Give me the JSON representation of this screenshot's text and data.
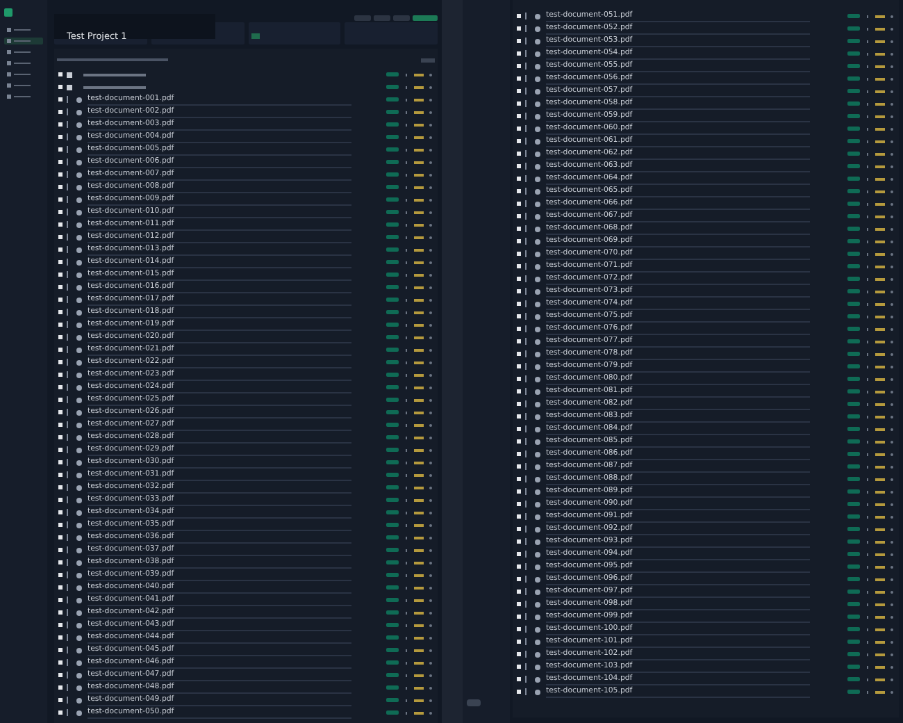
{
  "project": {
    "title": "Test Project 1"
  },
  "sidebar": {
    "items": [
      {
        "selected": false
      },
      {
        "selected": true
      },
      {
        "selected": false
      },
      {
        "selected": false
      },
      {
        "selected": false
      },
      {
        "selected": false
      },
      {
        "selected": false
      }
    ]
  },
  "left_documents": [
    "test-document-001.pdf",
    "test-document-002.pdf",
    "test-document-003.pdf",
    "test-document-004.pdf",
    "test-document-005.pdf",
    "test-document-006.pdf",
    "test-document-007.pdf",
    "test-document-008.pdf",
    "test-document-009.pdf",
    "test-document-010.pdf",
    "test-document-011.pdf",
    "test-document-012.pdf",
    "test-document-013.pdf",
    "test-document-014.pdf",
    "test-document-015.pdf",
    "test-document-016.pdf",
    "test-document-017.pdf",
    "test-document-018.pdf",
    "test-document-019.pdf",
    "test-document-020.pdf",
    "test-document-021.pdf",
    "test-document-022.pdf",
    "test-document-023.pdf",
    "test-document-024.pdf",
    "test-document-025.pdf",
    "test-document-026.pdf",
    "test-document-027.pdf",
    "test-document-028.pdf",
    "test-document-029.pdf",
    "test-document-030.pdf",
    "test-document-031.pdf",
    "test-document-032.pdf",
    "test-document-033.pdf",
    "test-document-034.pdf",
    "test-document-035.pdf",
    "test-document-036.pdf",
    "test-document-037.pdf",
    "test-document-038.pdf",
    "test-document-039.pdf",
    "test-document-040.pdf",
    "test-document-041.pdf",
    "test-document-042.pdf",
    "test-document-043.pdf",
    "test-document-044.pdf",
    "test-document-045.pdf",
    "test-document-046.pdf",
    "test-document-047.pdf",
    "test-document-048.pdf",
    "test-document-049.pdf",
    "test-document-050.pdf"
  ],
  "right_documents": [
    "test-document-051.pdf",
    "test-document-052.pdf",
    "test-document-053.pdf",
    "test-document-054.pdf",
    "test-document-055.pdf",
    "test-document-056.pdf",
    "test-document-057.pdf",
    "test-document-058.pdf",
    "test-document-059.pdf",
    "test-document-060.pdf",
    "test-document-061.pdf",
    "test-document-062.pdf",
    "test-document-063.pdf",
    "test-document-064.pdf",
    "test-document-065.pdf",
    "test-document-066.pdf",
    "test-document-067.pdf",
    "test-document-068.pdf",
    "test-document-069.pdf",
    "test-document-070.pdf",
    "test-document-071.pdf",
    "test-document-072.pdf",
    "test-document-073.pdf",
    "test-document-074.pdf",
    "test-document-075.pdf",
    "test-document-076.pdf",
    "test-document-077.pdf",
    "test-document-078.pdf",
    "test-document-079.pdf",
    "test-document-080.pdf",
    "test-document-081.pdf",
    "test-document-082.pdf",
    "test-document-083.pdf",
    "test-document-084.pdf",
    "test-document-085.pdf",
    "test-document-086.pdf",
    "test-document-087.pdf",
    "test-document-088.pdf",
    "test-document-089.pdf",
    "test-document-090.pdf",
    "test-document-091.pdf",
    "test-document-092.pdf",
    "test-document-093.pdf",
    "test-document-094.pdf",
    "test-document-095.pdf",
    "test-document-096.pdf",
    "test-document-097.pdf",
    "test-document-098.pdf",
    "test-document-099.pdf",
    "test-document-100.pdf",
    "test-document-101.pdf",
    "test-document-102.pdf",
    "test-document-103.pdf",
    "test-document-104.pdf",
    "test-document-105.pdf"
  ]
}
